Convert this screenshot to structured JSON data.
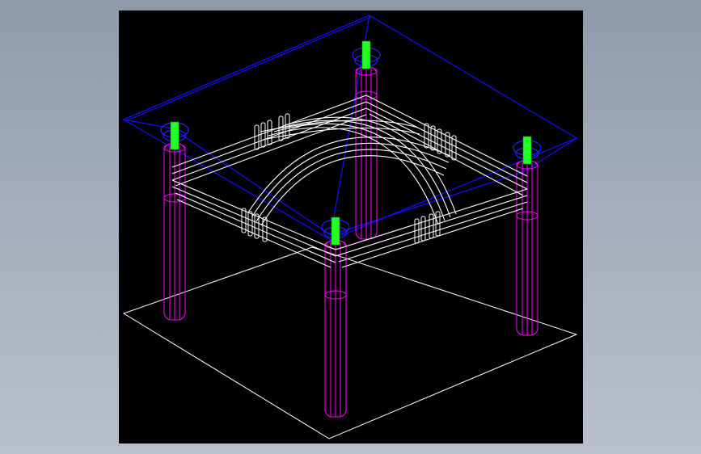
{
  "background": {
    "gradient_top": "#8e9aaa",
    "gradient_bottom": "#b9c0cb"
  },
  "viewport": {
    "background": "#000000",
    "wireframe_colors": {
      "floor_outline": "#ffffff",
      "glass_top": "#1010ff",
      "legs": "#ff00ff",
      "caps": "#22ff22",
      "frame": "#ffffff"
    }
  }
}
